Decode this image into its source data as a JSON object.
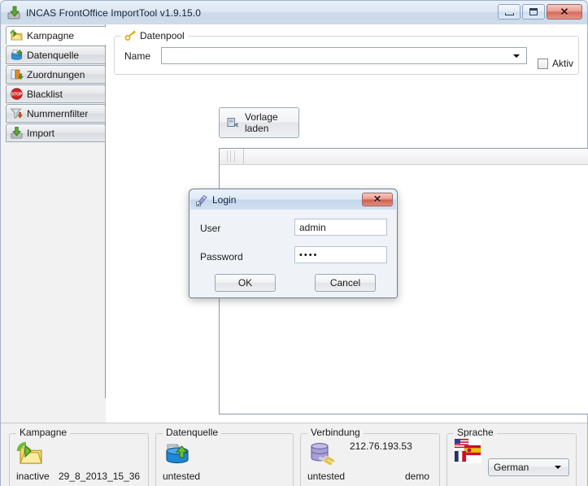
{
  "window": {
    "title": "INCAS FrontOffice ImportTool v1.9.15.0",
    "icon": "green-download-arrow-icon",
    "buttons": {
      "minimize": "minimize-icon",
      "maximize": "maximize-icon",
      "close": "close-icon"
    }
  },
  "sidebar": {
    "items": [
      {
        "label": "Kampagne",
        "icon": "folder-refresh-icon",
        "selected": true
      },
      {
        "label": "Datenquelle",
        "icon": "database-upload-icon",
        "selected": false
      },
      {
        "label": "Zuordnungen",
        "icon": "column-mapping-icon",
        "selected": false
      },
      {
        "label": "Blacklist",
        "icon": "stop-sign-icon",
        "selected": false
      },
      {
        "label": "Nummernfilter",
        "icon": "funnel-filter-icon",
        "selected": false
      },
      {
        "label": "Import",
        "icon": "import-arrow-icon",
        "selected": false
      }
    ]
  },
  "main": {
    "datenpool": {
      "title": "Datenpool",
      "icon": "key-icon",
      "name_label": "Name",
      "name_value": "",
      "name_placeholder": "",
      "aktiv_label": "Aktiv",
      "aktiv_checked": false
    },
    "vorlage_button": {
      "label": "Vorlage laden",
      "icon": "template-load-icon"
    },
    "grid": {
      "columns": [],
      "rows": []
    }
  },
  "status": {
    "kampagne": {
      "title": "Kampagne",
      "icon": "folder-refresh-icon",
      "state": "inactive",
      "value": "29_8_2013_15_36"
    },
    "datenquelle": {
      "title": "Datenquelle",
      "icon": "database-upload-icon",
      "state": "untested",
      "value": ""
    },
    "verbindung": {
      "title": "Verbindung",
      "icon": "database-plug-icon",
      "state": "untested",
      "address": "212.76.193.53",
      "value": "demo"
    },
    "sprache": {
      "title": "Sprache",
      "icon": "flags-icon",
      "selected": "German",
      "options": [
        "German",
        "English",
        "French",
        "Spanish"
      ]
    }
  },
  "login_dialog": {
    "title": "Login",
    "icon": "login-key-icon",
    "close_label": "close-icon",
    "user_label": "User",
    "user_value": "admin",
    "password_label": "Password",
    "password_value": "••••",
    "ok_label": "OK",
    "cancel_label": "Cancel"
  },
  "colors": {
    "window_frame": "#c9d7e8",
    "titlebar": "#dee8f3",
    "content_bg": "#ffffff",
    "sidebar_bg": "#f2f2f2",
    "statusbar_bg": "#f1f1f1",
    "close_button": "#d5685a",
    "accent_green": "#5aab2e"
  }
}
